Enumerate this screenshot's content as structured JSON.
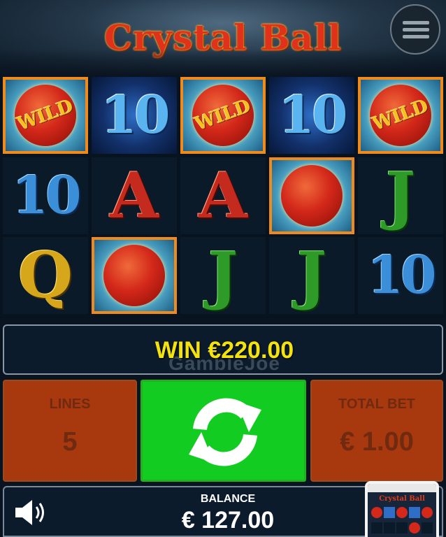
{
  "game": {
    "title": "Crystal Ball"
  },
  "reels": {
    "rows": [
      [
        {
          "symbol": "WILD",
          "kind": "wild",
          "highlighted": true
        },
        {
          "symbol": "10",
          "kind": "ten",
          "highlighted": false,
          "lit": true
        },
        {
          "symbol": "WILD",
          "kind": "wild",
          "highlighted": true
        },
        {
          "symbol": "10",
          "kind": "ten",
          "highlighted": false,
          "lit": true
        },
        {
          "symbol": "WILD",
          "kind": "wild",
          "highlighted": true
        }
      ],
      [
        {
          "symbol": "10",
          "kind": "ten",
          "highlighted": false
        },
        {
          "symbol": "A",
          "kind": "ace",
          "highlighted": false
        },
        {
          "symbol": "A",
          "kind": "ace",
          "highlighted": false
        },
        {
          "symbol": "",
          "kind": "ball",
          "highlighted": true
        },
        {
          "symbol": "J",
          "kind": "jack",
          "highlighted": false
        }
      ],
      [
        {
          "symbol": "Q",
          "kind": "queen",
          "highlighted": false
        },
        {
          "symbol": "",
          "kind": "ball",
          "highlighted": true
        },
        {
          "symbol": "J",
          "kind": "jack",
          "highlighted": false
        },
        {
          "symbol": "J",
          "kind": "jack",
          "highlighted": false
        },
        {
          "symbol": "10",
          "kind": "ten",
          "highlighted": false
        }
      ]
    ]
  },
  "win": {
    "text": "WIN €220.00",
    "watermark": "GambleJoe"
  },
  "controls": {
    "lines_label": "LINES",
    "lines_value": "5",
    "total_bet_label": "TOTAL BET",
    "total_bet_value": "€ 1.00",
    "spin_icon": "refresh-arrows-icon"
  },
  "balance": {
    "label": "BALANCE",
    "value": "€ 127.00"
  },
  "icons": {
    "menu": "hamburger-menu-icon",
    "sound": "speaker-icon"
  },
  "thumbnail": {
    "title": "Crystal Ball"
  },
  "colors": {
    "spin_green": "#12cc22",
    "panel_rust": "#a8380e",
    "win_yellow": "#f3e20f",
    "highlight_orange": "#f08a1a"
  }
}
